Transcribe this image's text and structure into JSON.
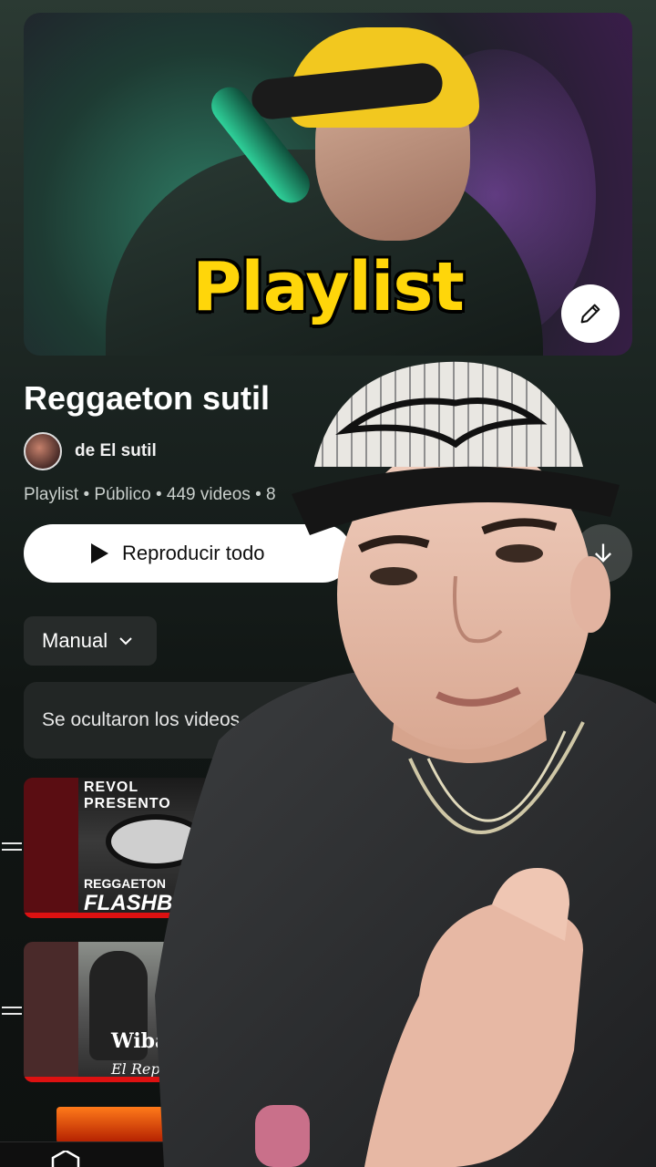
{
  "overlay_title": "Playlist",
  "playlist": {
    "title": "Reggaeton sutil",
    "owner": "de El sutil",
    "meta": "Playlist • Público • 449 videos • 8",
    "play_all_label": "Reproducir todo",
    "sort_label": "Manual",
    "hidden_notice": "Se ocultaron los videos"
  },
  "videos": [
    {
      "thumb_top": "REVOL PRESENTO",
      "thumb_line1": "REGGAETON",
      "thumb_line2": "FLASHBA"
    },
    {
      "thumb_top": "",
      "thumb_line1": "Wibal A",
      "thumb_line2": "El Reperto"
    }
  ],
  "icons": [
    "pencil-icon",
    "play-icon",
    "download-icon",
    "chevron-down-icon",
    "drag-handle-icon",
    "home-icon"
  ],
  "colors": {
    "overlay_yellow": "#ffd60a",
    "accent_red": "#dd1111",
    "background": "#111614"
  }
}
